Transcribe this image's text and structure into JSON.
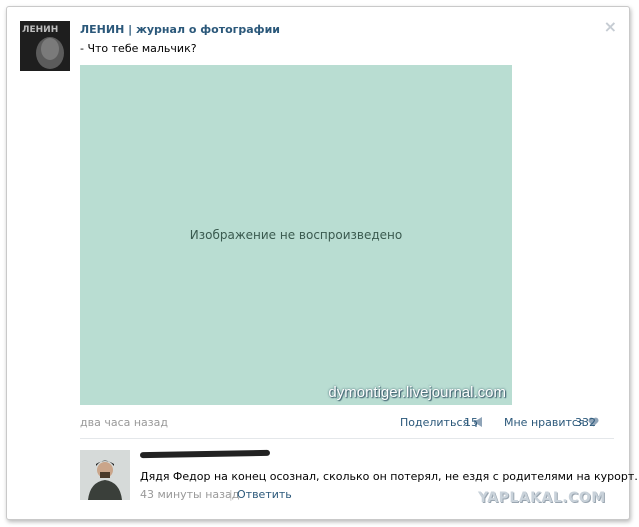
{
  "post": {
    "author": "ЛЕНИН | журнал о фотографии",
    "avatar_text": "ЛЕНИН",
    "text": "- Что тебе мальчик?",
    "image_placeholder": "Изображение не воспроизведено",
    "image_watermark": "dymontiger.livejournal.com",
    "time": "два часа назад",
    "share_label": "Поделиться",
    "share_count": "15",
    "like_label": "Мне нравится",
    "like_count": "332"
  },
  "comment": {
    "text": "Дядя Федор на конец осознал, сколько он потерял, не ездя с родителями на курорт…",
    "time": "43 минуты назад",
    "separator": "|",
    "reply_label": "Ответить"
  },
  "site_watermark": "YAPLAKAL.COM",
  "icons": {
    "close": "close-icon",
    "share": "megaphone-icon",
    "like": "heart-icon"
  },
  "colors": {
    "link": "#2b587a",
    "muted": "#999999",
    "divider": "#e4e7ea"
  }
}
